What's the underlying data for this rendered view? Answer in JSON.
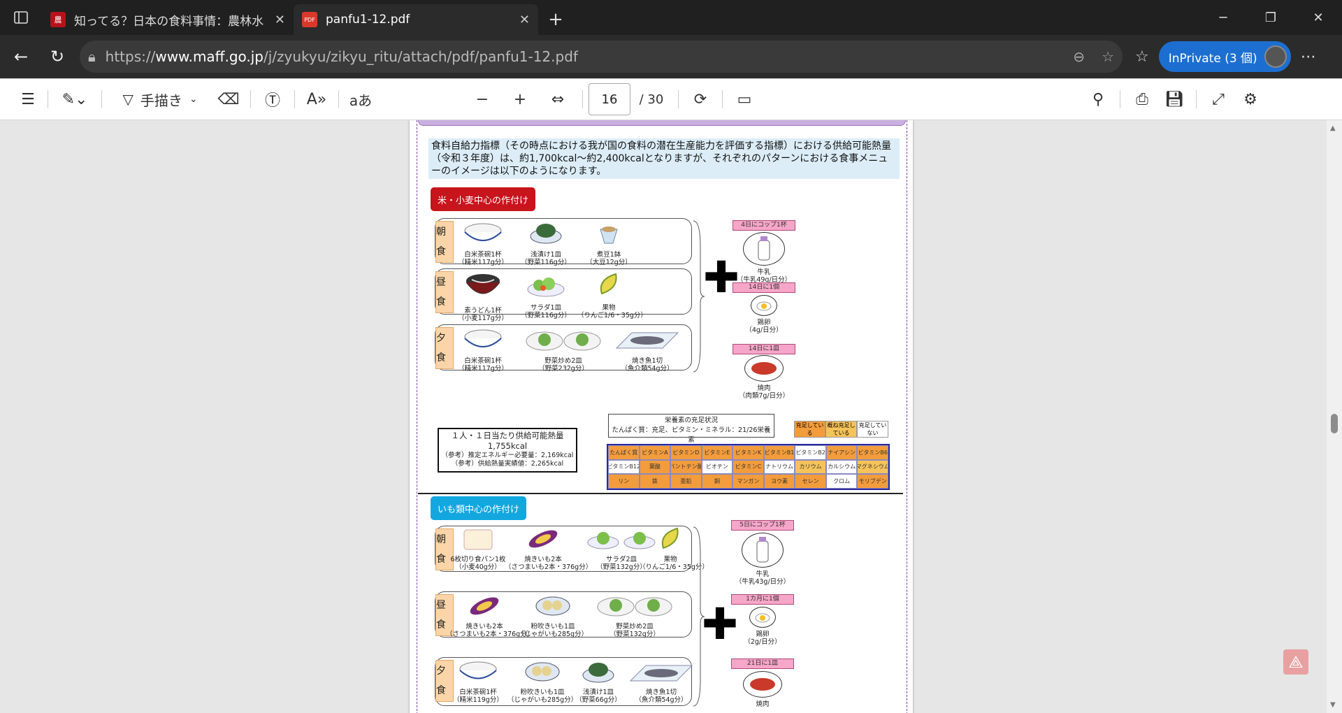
{
  "tabs": [
    {
      "title": "知ってる？日本の食料事情：農林水",
      "fav": "農"
    },
    {
      "title": "panfu1-12.pdf",
      "fav": "PDF"
    }
  ],
  "address": {
    "prefix": "https://",
    "host": "www.maff.go.jp",
    "path": "/j/zyukyu/zikyu_ritu/attach/pdf/panfu1-12.pdf"
  },
  "inprivate": "InPrivate (3 個)",
  "toolbar": {
    "draw_label": "手描き",
    "read_aloud": "aあ",
    "page": "16",
    "total": "/ 30"
  },
  "doc": {
    "intro": "食料自給力指標（その時点における我が国の食料の潜在生産能力を評価する指標）における供給可能熱量（令和３年度）は、約1,700kcal～約2,400kcalとなりますが、それぞれのパターンにおける食事メニューのイメージは以下のようになります。",
    "section1": "米・小麦中心の作付け",
    "section2": "いも類中心の作付け",
    "meals": {
      "breakfast": "朝食",
      "lunch": "昼食",
      "dinner": "夕食"
    },
    "s1": {
      "breakfast": [
        {
          "n": "白米茶碗1杯",
          "d": "（精米117g分）"
        },
        {
          "n": "浅漬け1皿",
          "d": "（野菜116g分）"
        },
        {
          "n": "煮豆1鉢",
          "d": "（大豆12g分）"
        }
      ],
      "lunch": [
        {
          "n": "素うどん1杯",
          "d": "（小麦117g分）"
        },
        {
          "n": "サラダ1皿",
          "d": "（野菜116g分）"
        },
        {
          "n": "果物",
          "d": "（りんご1/6・35g分）"
        }
      ],
      "dinner": [
        {
          "n": "白米茶碗1杯",
          "d": "（精米117g分）"
        },
        {
          "n": "野菜炒め2皿",
          "d": "（野菜232g分）"
        },
        {
          "n": "焼き魚1切",
          "d": "（魚介類54g分）"
        }
      ],
      "side": [
        {
          "tag": "4日にコップ1杯",
          "n": "牛乳",
          "d": "（牛乳49g/日分）"
        },
        {
          "tag": "14日に1個",
          "n": "鶏卵",
          "d": "（4g/日分）"
        },
        {
          "tag": "14日に1皿",
          "n": "焼肉",
          "d": "（肉類7g/日分）"
        }
      ]
    },
    "kcal": {
      "h": "１人・１日当たり供給可能熱量",
      "v": "1,755kcal",
      "r1": "（参考）推定エネルギー必要量：2,169kcal",
      "r2": "（参考）供給熱量実績値：2,265kcal"
    },
    "nutrition": {
      "title": "栄養素の充足状況",
      "line": "たんぱく質：充足、ビタミン・ミネラル：21/26栄養素"
    },
    "legend": [
      "充足している",
      "概ね充足している",
      "充足していない"
    ],
    "nutrients": [
      "たんぱく質",
      "ビタミンA",
      "ビタミンD",
      "ビタミンE",
      "ビタミンK",
      "ビタミンB1",
      "ビタミンB2",
      "ナイアシン",
      "ビタミンB6",
      "ビタミンB12",
      "葉酸",
      "パントテン酸",
      "ビオチン",
      "ビタミンC",
      "ナトリウム",
      "カリウム",
      "カルシウム",
      "マグネシウム",
      "リン",
      "鉄",
      "亜鉛",
      "銅",
      "マンガン",
      "ヨウ素",
      "セレン",
      "クロム",
      "モリブデン"
    ],
    "s2": {
      "breakfast": [
        {
          "n": "6枚切り食パン1枚",
          "d": "（小麦40g分）"
        },
        {
          "n": "焼きいも2本",
          "d": "（さつまいも2本・376g分）"
        },
        {
          "n": "サラダ2皿",
          "d": "（野菜132g分）"
        },
        {
          "n": "果物",
          "d": "（りんご1/6・35g分）"
        }
      ],
      "lunch": [
        {
          "n": "焼きいも2本",
          "d": "（さつまいも2本・376g分）"
        },
        {
          "n": "粉吹きいも1皿",
          "d": "（じゃがいも285g分）"
        },
        {
          "n": "野菜炒め2皿",
          "d": "（野菜132g分）"
        }
      ],
      "dinner": [
        {
          "n": "白米茶碗1杯",
          "d": "（精米119g分）"
        },
        {
          "n": "粉吹きいも1皿",
          "d": "（じゃがいも285g分）"
        },
        {
          "n": "浅漬け1皿",
          "d": "（野菜66g分）"
        },
        {
          "n": "焼き魚1切",
          "d": "（魚介類54g分）"
        }
      ],
      "side": [
        {
          "tag": "5日にコップ1杯",
          "n": "牛乳",
          "d": "（牛乳43g/日分）"
        },
        {
          "tag": "1カ月に1個",
          "n": "鶏卵",
          "d": "（2g/日分）"
        },
        {
          "tag": "21日に1皿",
          "n": "焼肉",
          "d": ""
        }
      ]
    }
  }
}
